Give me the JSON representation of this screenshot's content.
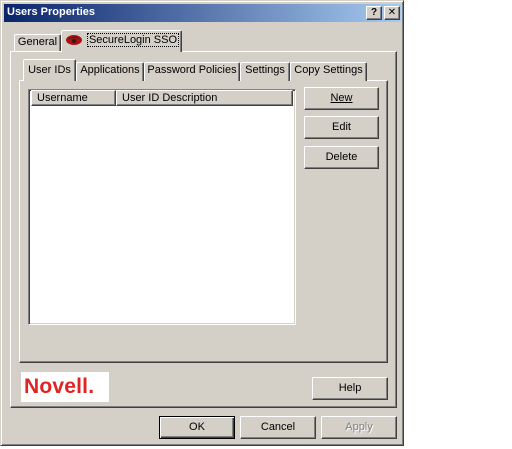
{
  "window": {
    "title": "Users Properties"
  },
  "titlebar": {
    "help_label": "?",
    "close_label": "✕"
  },
  "outer_tabs": [
    {
      "label": "General"
    },
    {
      "label": "SecureLogin SSO"
    }
  ],
  "inner_tabs": [
    {
      "label": "User IDs"
    },
    {
      "label": "Applications"
    },
    {
      "label": "Password Policies"
    },
    {
      "label": "Settings"
    },
    {
      "label": "Copy Settings"
    }
  ],
  "list": {
    "columns": [
      {
        "label": "Username"
      },
      {
        "label": "User ID Description"
      }
    ],
    "rows": []
  },
  "side_buttons": {
    "new_label": "New",
    "edit_label": "Edit",
    "delete_label": "Delete"
  },
  "logo_text": "Novell.",
  "help_label": "Help",
  "footer": {
    "ok_label": "OK",
    "cancel_label": "Cancel",
    "apply_label": "Apply"
  },
  "colors": {
    "title_gradient_start": "#0a246a",
    "title_gradient_end": "#a6caf0",
    "face": "#d4d0c8",
    "logo_red": "#e02424"
  }
}
